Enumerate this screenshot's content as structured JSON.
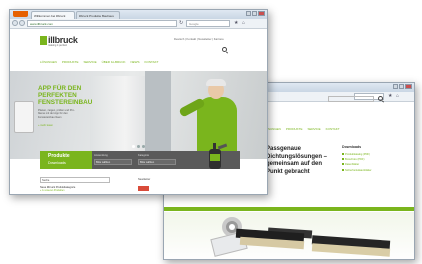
{
  "front_window": {
    "tabs": [
      "Willkommen bei illbruck",
      "illbruck Produkte Bauhaus"
    ],
    "url": "www.illbruck.com",
    "search_placeholder": "Google",
    "logo": {
      "name": "illbruck",
      "tagline": "making it perfect"
    },
    "meta_links": "Deutsch | Kontakt | Newsletter | Karriere",
    "menu": [
      "LÖSUNGEN",
      "PRODUKTE",
      "SERVICE",
      "ÜBER ILLBRUCK",
      "NEWS",
      "KONTAKT"
    ],
    "hero": {
      "title": "APP FÜR DEN\nPERFEKTEN\nFENSTEREINBAU",
      "text": "Planen, zeigen, prüfen und Pro-\nbleme mit der App für den\nFenstereinbau lösen",
      "link": "» mehr lesen"
    },
    "band": {
      "title": "Produkte",
      "subtitle": "Downloads",
      "select1_label": "Anwendung",
      "select1_value": "Bitte wählen",
      "select2_label": "Kategorie",
      "select2_value": "Bitte wählen"
    },
    "lower": {
      "input_value": "Suche",
      "label": "Neue illbruck Produktkategorie",
      "sublabel": "» zu unseren Produkten",
      "right_label": "Newsletter"
    }
  },
  "back_window": {
    "heading": "Passgenaue\nDichtungslösungen – gemeinsam auf den\nPunkt gebracht",
    "menu": [
      "LÖSUNGEN",
      "PRODUKTE",
      "SERVICE",
      "KONTAKT"
    ],
    "downloads_title": "Downloads",
    "downloads": [
      "Produktkatalog (PDF)",
      "Broschüre (PDF)",
      "Datenblätter",
      "Sicherheitsdatenblätter"
    ]
  },
  "colors": {
    "accent": "#7ab51d",
    "dark_band": "#5a5a5a",
    "firefox_button": "#e66000"
  },
  "icons": [
    "back-icon",
    "forward-icon",
    "reload-icon",
    "home-icon",
    "bookmark-icon",
    "search-icon"
  ]
}
